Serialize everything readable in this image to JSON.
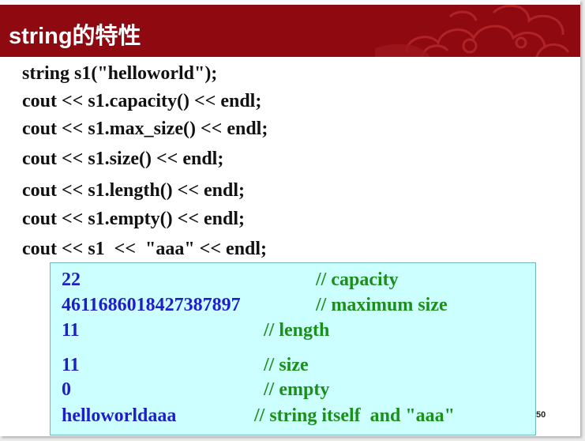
{
  "title": "string的特性",
  "code_lines": [
    "string s1(\"helloworld\");",
    "cout << s1.capacity() << endl;",
    "cout << s1.max_size() << endl;",
    "cout << s1.size() << endl;",
    "cout << s1.length() << endl;",
    "cout << s1.empty() << endl;",
    "cout << s1  <<  \"aaa\" << endl;"
  ],
  "output": [
    {
      "value": "22",
      "comment": "// capacity"
    },
    {
      "value": "4611686018427387897",
      "comment": "// maximum size"
    },
    {
      "value": "11",
      "comment": "// length"
    },
    {
      "value": "11",
      "comment": "// size"
    },
    {
      "value": "0",
      "comment": "// empty"
    },
    {
      "value": "helloworldaaa",
      "comment": "// string itself  and \"aaa\""
    }
  ],
  "page_number": "50",
  "colors": {
    "title_bar": "#8e0a10",
    "output_bg": "#ccffff",
    "value_text": "#1f1fc8",
    "comment_text": "#1a8f1a"
  }
}
